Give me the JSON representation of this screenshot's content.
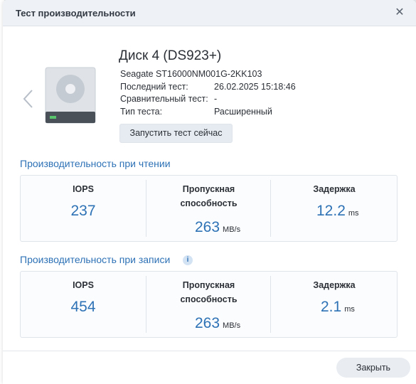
{
  "dialog": {
    "title": "Тест производительности",
    "close_glyph": "✕"
  },
  "disk": {
    "name": "Диск 4 (DS923+)",
    "model": "Seagate ST16000NM001G-2KK103",
    "rows": [
      {
        "label": "Последний тест:",
        "value": "26.02.2025 15:18:46"
      },
      {
        "label": "Сравнительный тест:",
        "value": "-"
      },
      {
        "label": "Тип теста:",
        "value": "Расширенный"
      }
    ],
    "run_button": "Запустить тест сейчас"
  },
  "read": {
    "title": "Производительность при чтении",
    "iops_label": "IOPS",
    "iops_value": "237",
    "throughput_label_1": "Пропускная",
    "throughput_label_2": "способность",
    "throughput_value": "263",
    "throughput_unit": "MB/s",
    "latency_label": "Задержка",
    "latency_value": "12.2",
    "latency_unit": "ms"
  },
  "write": {
    "title": "Производительность при записи",
    "info_glyph": "i",
    "iops_label": "IOPS",
    "iops_value": "454",
    "throughput_label_1": "Пропускная",
    "throughput_label_2": "способность",
    "throughput_value": "263",
    "throughput_unit": "MB/s",
    "latency_label": "Задержка",
    "latency_value": "2.1",
    "latency_unit": "ms"
  },
  "footer": {
    "close_button": "Закрыть"
  },
  "colors": {
    "accent": "#2e72b6",
    "titlebar": "#eef1f5"
  }
}
